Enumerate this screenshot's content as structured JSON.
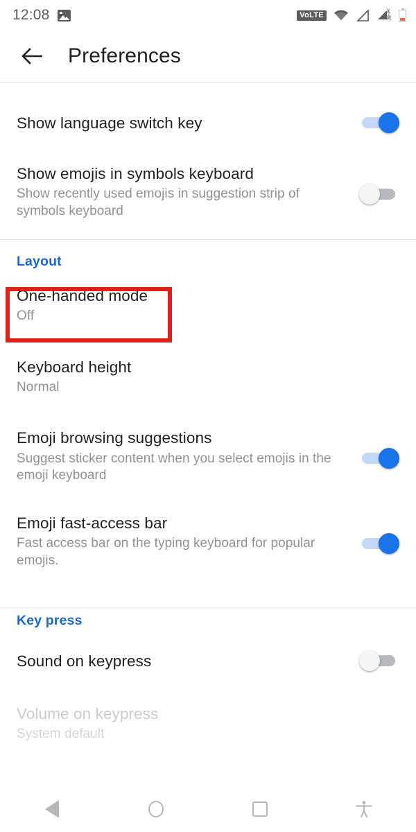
{
  "status_bar": {
    "time": "12:08",
    "notification_icon": "photo-icon",
    "volte_label": "VoLTE",
    "signal_x_label": "X",
    "signal_r_label": "R",
    "icons": [
      "photo-icon",
      "volte-icon",
      "wifi-icon",
      "signal-empty-icon",
      "signal-roaming-icon",
      "battery-icon"
    ]
  },
  "appbar": {
    "back_icon": "back-arrow-icon",
    "title": "Preferences"
  },
  "sections": [
    {
      "header": null,
      "rows": [
        {
          "name": "show-language-switch-key",
          "title": "Show language switch key",
          "subtitle": null,
          "control": "switch",
          "state": "on"
        },
        {
          "name": "show-emojis-in-symbols-keyboard",
          "title": "Show emojis in symbols keyboard",
          "subtitle": "Show recently used emojis in suggestion strip of symbols keyboard",
          "control": "switch",
          "state": "off"
        }
      ]
    },
    {
      "header": "Layout",
      "rows": [
        {
          "name": "one-handed-mode",
          "title": "One-handed mode",
          "subtitle": "Off",
          "control": "none",
          "state": null,
          "highlighted": true
        },
        {
          "name": "keyboard-height",
          "title": "Keyboard height",
          "subtitle": "Normal",
          "control": "none",
          "state": null
        },
        {
          "name": "emoji-browsing-suggestions",
          "title": "Emoji browsing suggestions",
          "subtitle": "Suggest sticker content when you select emojis in the emoji keyboard",
          "control": "switch",
          "state": "on"
        },
        {
          "name": "emoji-fast-access-bar",
          "title": "Emoji fast-access bar",
          "subtitle": "Fast access bar on the typing keyboard for popular emojis.",
          "control": "switch",
          "state": "on"
        }
      ]
    },
    {
      "header": "Key press",
      "rows": [
        {
          "name": "sound-on-keypress",
          "title": "Sound on keypress",
          "subtitle": null,
          "control": "switch",
          "state": "off"
        },
        {
          "name": "volume-on-keypress",
          "title": "Volume on keypress",
          "subtitle": "System default",
          "control": "none",
          "state": null,
          "disabled": true
        }
      ]
    }
  ],
  "annotation": {
    "color": "#e0201b",
    "target": "one-handed-mode"
  },
  "navbar": {
    "back_label": "back-triangle-icon",
    "home_label": "home-circle-icon",
    "recents_label": "recents-square-icon",
    "accessibility_label": "accessibility-icon"
  },
  "colors": {
    "accent_blue": "#1a73e8",
    "section_header_blue": "#1967d2",
    "primary_text": "#202124",
    "secondary_text": "#8f9194",
    "disabled_text": "#c9cbce",
    "divider": "#e4e5e7",
    "annotation_red": "#e0201b"
  }
}
